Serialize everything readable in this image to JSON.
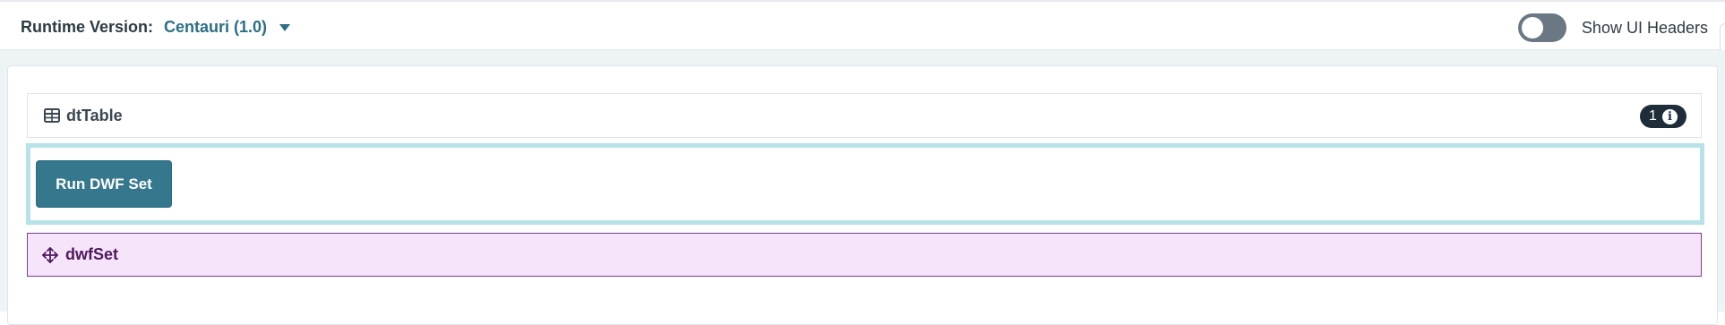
{
  "header": {
    "runtime_label": "Runtime Version:",
    "runtime_value": "Centauri (1.0)",
    "show_ui_headers_label": "Show UI Headers",
    "show_ui_headers_enabled": false
  },
  "components": {
    "dt_table": {
      "title": "dtTable",
      "icon": "table-icon",
      "badge_count": "1",
      "badge_icon": "info-icon"
    },
    "run_panel": {
      "button_label": "Run DWF Set"
    },
    "dwf_set": {
      "title": "dwfSet",
      "icon": "move-arrows-icon"
    }
  },
  "colors": {
    "accent": "#2a6f85",
    "button": "#35788e",
    "panel_highlight": "#b9e2e8",
    "dwf_background": "#f6e4fa",
    "dwf_border": "#7a3e8f",
    "badge": "#1f2d3a"
  }
}
